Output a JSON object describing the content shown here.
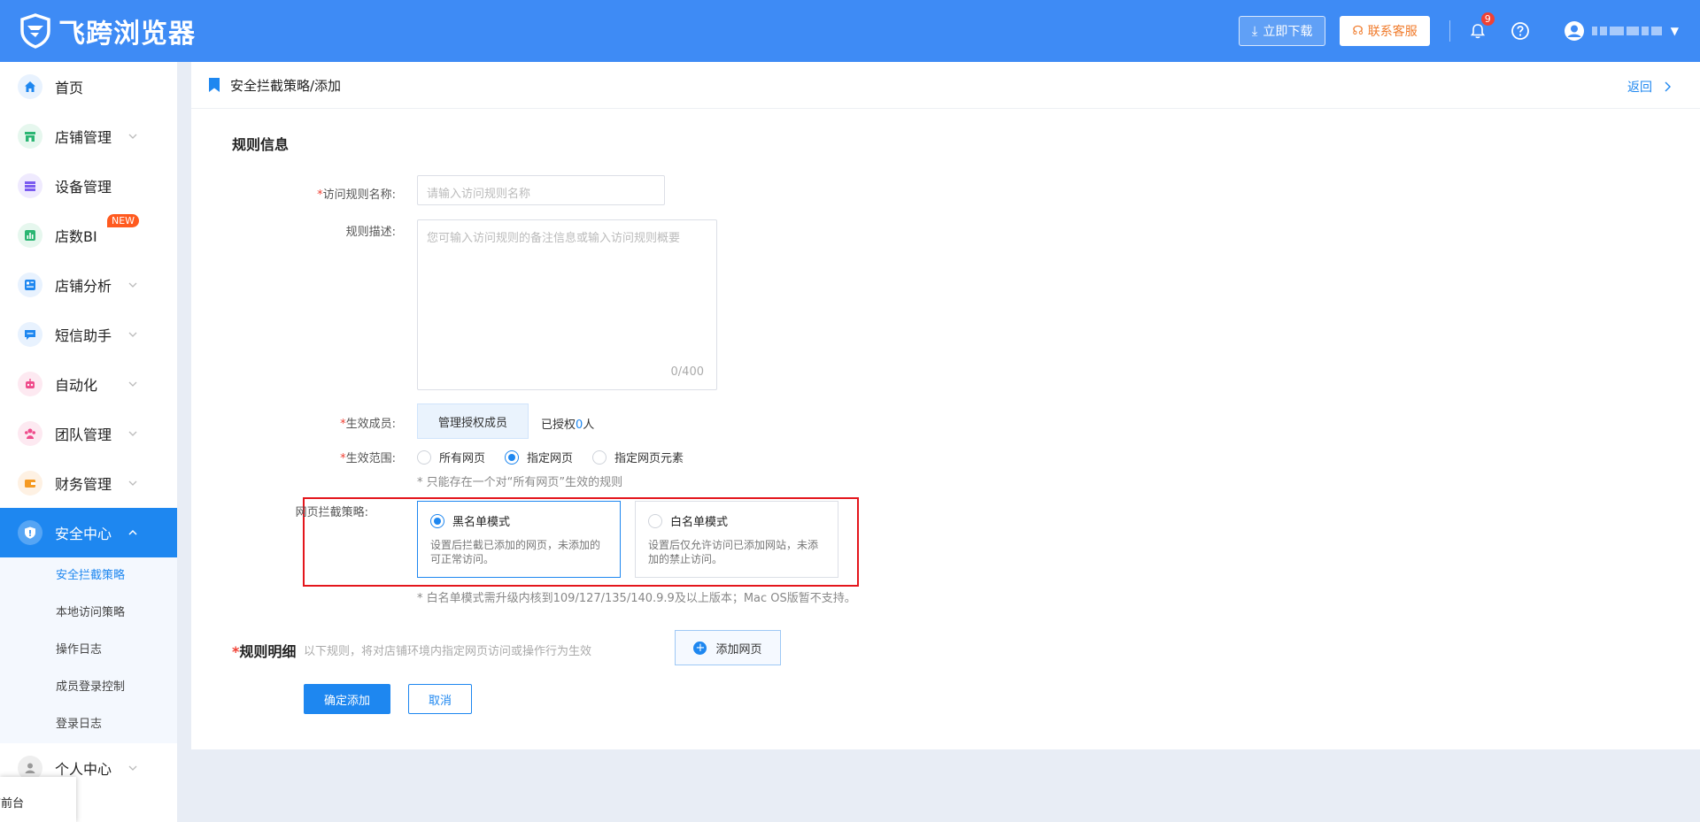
{
  "header": {
    "logo_text": "飞跨浏览器",
    "download_label": "立即下载",
    "service_label": "联系客服",
    "notification_count": "9"
  },
  "sidebar": {
    "items": [
      {
        "label": "首页",
        "icon": "home-icon",
        "color": "#1e87f0"
      },
      {
        "label": "店铺管理",
        "icon": "store-icon",
        "color": "#2bb673"
      },
      {
        "label": "设备管理",
        "icon": "device-icon",
        "color": "#7b5cf0"
      },
      {
        "label": "店数BI",
        "icon": "bi-chart-icon",
        "color": "#2bb673",
        "badge": "NEW"
      },
      {
        "label": "店铺分析",
        "icon": "analysis-icon",
        "color": "#1e87f0"
      },
      {
        "label": "短信助手",
        "icon": "sms-icon",
        "color": "#1e87f0"
      },
      {
        "label": "自动化",
        "icon": "robot-icon",
        "color": "#ef4b8b"
      },
      {
        "label": "团队管理",
        "icon": "team-icon",
        "color": "#ef4b8b"
      },
      {
        "label": "财务管理",
        "icon": "wallet-icon",
        "color": "#f59a23"
      },
      {
        "label": "安全中心",
        "icon": "shield-icon",
        "color": "#ffffff"
      }
    ],
    "sub_items": [
      "安全拦截策略",
      "本地访问策略",
      "操作日志",
      "成员登录控制",
      "登录日志"
    ],
    "personal_center": "个人中心",
    "float_tab": "店前台"
  },
  "breadcrumb": {
    "title": "安全拦截策略/添加",
    "back_label": "返回"
  },
  "form": {
    "section_title": "规则信息",
    "name_label": "访问规则名称:",
    "name_placeholder": "请输入访问规则名称",
    "desc_label": "规则描述:",
    "desc_placeholder": "您可输入访问规则的备注信息或输入访问规则概要",
    "desc_count": "0/400",
    "members_label": "生效成员:",
    "members_button": "管理授权成员",
    "granted_prefix": "已授权",
    "granted_count": "0",
    "granted_suffix": "人",
    "scope_label": "生效范围:",
    "scope_options": [
      "所有网页",
      "指定网页",
      "指定网页元素"
    ],
    "scope_selected": "指定网页",
    "scope_hint": "* 只能存在一个对“所有网页”生效的规则",
    "strategy_label": "网页拦截策略:",
    "blacklist_title": "黑名单模式",
    "blacklist_desc": "设置后拦截已添加的网页，未添加的可正常访问。",
    "whitelist_title": "白名单模式",
    "whitelist_desc": "设置后仅允许访问已添加网站，未添加的禁止访问。",
    "strategy_hint": "* 白名单模式需升级内核到109/127/135/140.9.9及以上版本；Mac OS版暂不支持。",
    "rules_title": "规则明细",
    "rules_sub": "以下规则，将对店铺环境内指定网页访问或操作行为生效",
    "add_page_label": "添加网页",
    "confirm_label": "确定添加",
    "cancel_label": "取消"
  }
}
